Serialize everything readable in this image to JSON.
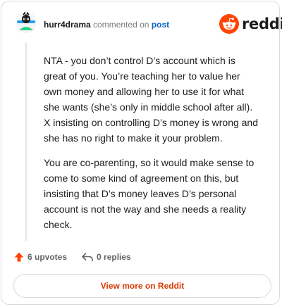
{
  "header": {
    "username": "hurr4drama",
    "commented_on": "commented on",
    "post_link": "post",
    "logo_text": "reddit"
  },
  "comment": {
    "paragraphs": [
      "NTA - you don’t control D’s account which is great of you. You’re teaching her to value her own money and allowing her to use it for what she wants (she’s only in middle school after all). X insisting on controlling D’s money is wrong and she has no right to make it your problem.",
      "You are co-parenting, so it would make sense to come to some kind of agreement on this, but insisting that D’s money leaves D’s personal account is not the way and she needs a reality check."
    ]
  },
  "actions": {
    "upvotes": "6 upvotes",
    "replies": "0 replies"
  },
  "cta": {
    "label": "View more on Reddit"
  },
  "colors": {
    "accent": "#ff4500",
    "link": "#0a66c2",
    "cta_text": "#d93a00"
  },
  "icons": {
    "avatar": "avatar-icon",
    "logo": "reddit-snoo-icon",
    "upvote": "upvote-arrow-icon",
    "reply": "reply-arrow-icon"
  }
}
